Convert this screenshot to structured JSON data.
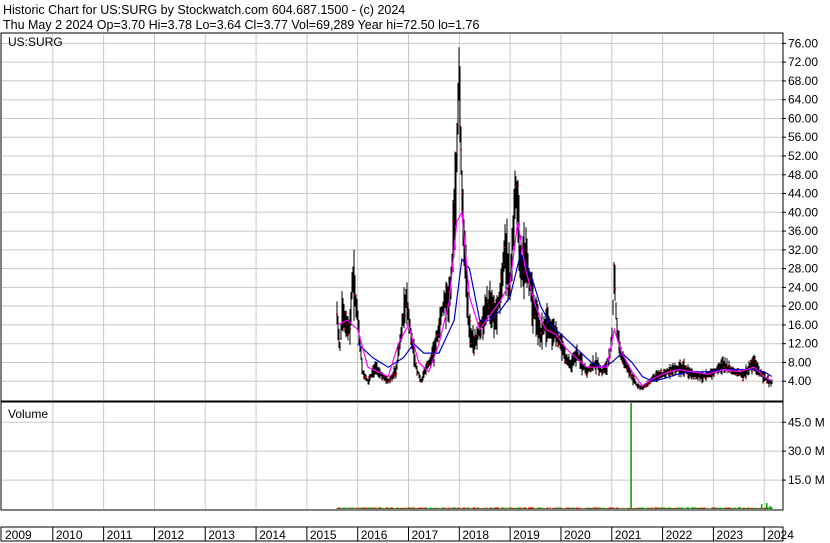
{
  "header": {
    "line1": "Historic Chart for US:SURG by Stockwatch.com 604.687.1500 - (c) 2024",
    "line2": "Thu May  2 2024  Op=3.70  Hi=3.78  Lo=3.64  Cl=3.77  Vol=69,289  Year hi=72.50  lo=1.76"
  },
  "colors": {
    "price_bars": "#000000",
    "down_marks": "#cc0000",
    "ma_short": "#ff00ff",
    "ma_long": "#0000cc",
    "volume_bars": "#009900",
    "grid": "#c8c8c8"
  },
  "chart_data": [
    {
      "type": "line",
      "symbol_label": "US:SURG",
      "y_ticks": [
        "76.00",
        "72.00",
        "68.00",
        "64.00",
        "60.00",
        "56.00",
        "52.00",
        "48.00",
        "44.00",
        "40.00",
        "36.00",
        "32.00",
        "28.00",
        "24.00",
        "20.00",
        "16.00",
        "12.00",
        "8.00",
        "4.00"
      ],
      "ylim": [
        0,
        78
      ],
      "x_years": [
        "2009",
        "2010",
        "2011",
        "2012",
        "2013",
        "2014",
        "2015",
        "2016",
        "2017",
        "2018",
        "2019",
        "2020",
        "2021",
        "2022",
        "2023",
        "2024"
      ],
      "grid": true,
      "series": [
        {
          "key": "price",
          "points": [
            [
              2015.6,
              18
            ],
            [
              2015.65,
              11
            ],
            [
              2015.7,
              19
            ],
            [
              2015.8,
              15
            ],
            [
              2015.85,
              16
            ],
            [
              2015.9,
              27
            ],
            [
              2016.0,
              17
            ],
            [
              2016.1,
              6
            ],
            [
              2016.2,
              4
            ],
            [
              2016.35,
              7
            ],
            [
              2016.5,
              5
            ],
            [
              2016.6,
              4
            ],
            [
              2016.75,
              6
            ],
            [
              2016.85,
              14
            ],
            [
              2016.95,
              22
            ],
            [
              2017.05,
              14
            ],
            [
              2017.15,
              7
            ],
            [
              2017.25,
              4
            ],
            [
              2017.35,
              7
            ],
            [
              2017.5,
              10
            ],
            [
              2017.6,
              16
            ],
            [
              2017.7,
              21
            ],
            [
              2017.8,
              20
            ],
            [
              2017.85,
              28
            ],
            [
              2017.9,
              38
            ],
            [
              2017.95,
              52
            ],
            [
              2018.0,
              72.5
            ],
            [
              2018.05,
              45
            ],
            [
              2018.1,
              32
            ],
            [
              2018.2,
              14
            ],
            [
              2018.3,
              12
            ],
            [
              2018.4,
              15
            ],
            [
              2018.5,
              18
            ],
            [
              2018.6,
              21
            ],
            [
              2018.7,
              18
            ],
            [
              2018.8,
              22
            ],
            [
              2018.9,
              32
            ],
            [
              2019.0,
              25
            ],
            [
              2019.1,
              45
            ],
            [
              2019.15,
              40
            ],
            [
              2019.2,
              28
            ],
            [
              2019.3,
              30
            ],
            [
              2019.4,
              24
            ],
            [
              2019.5,
              18
            ],
            [
              2019.6,
              14
            ],
            [
              2019.7,
              16
            ],
            [
              2019.8,
              15
            ],
            [
              2019.9,
              14
            ],
            [
              2020.0,
              12
            ],
            [
              2020.1,
              9
            ],
            [
              2020.2,
              7
            ],
            [
              2020.3,
              10
            ],
            [
              2020.4,
              8
            ],
            [
              2020.5,
              6
            ],
            [
              2020.6,
              7
            ],
            [
              2020.7,
              8
            ],
            [
              2020.8,
              6
            ],
            [
              2020.9,
              7
            ],
            [
              2021.0,
              12
            ],
            [
              2021.05,
              28
            ],
            [
              2021.1,
              15
            ],
            [
              2021.2,
              9
            ],
            [
              2021.3,
              7
            ],
            [
              2021.4,
              5
            ],
            [
              2021.5,
              3
            ],
            [
              2021.6,
              2.5
            ],
            [
              2021.7,
              3.5
            ],
            [
              2021.8,
              4.5
            ],
            [
              2021.9,
              5
            ],
            [
              2022.0,
              5.5
            ],
            [
              2022.2,
              6.5
            ],
            [
              2022.4,
              7
            ],
            [
              2022.6,
              5.5
            ],
            [
              2022.8,
              5
            ],
            [
              2023.0,
              6
            ],
            [
              2023.2,
              7.5
            ],
            [
              2023.4,
              6
            ],
            [
              2023.6,
              5.5
            ],
            [
              2023.8,
              8
            ],
            [
              2023.9,
              6
            ],
            [
              2024.0,
              5
            ],
            [
              2024.1,
              3.8
            ],
            [
              2024.15,
              3.77
            ]
          ]
        },
        {
          "key": "ma_short",
          "points": [
            [
              2015.6,
              16
            ],
            [
              2015.8,
              17
            ],
            [
              2016.0,
              15
            ],
            [
              2016.2,
              7
            ],
            [
              2016.4,
              6
            ],
            [
              2016.6,
              5
            ],
            [
              2016.8,
              12
            ],
            [
              2017.0,
              16
            ],
            [
              2017.2,
              8
            ],
            [
              2017.4,
              6
            ],
            [
              2017.6,
              12
            ],
            [
              2017.8,
              21
            ],
            [
              2017.95,
              38
            ],
            [
              2018.05,
              40
            ],
            [
              2018.2,
              22
            ],
            [
              2018.4,
              15
            ],
            [
              2018.6,
              18
            ],
            [
              2018.8,
              21
            ],
            [
              2019.0,
              25
            ],
            [
              2019.15,
              38
            ],
            [
              2019.3,
              28
            ],
            [
              2019.5,
              20
            ],
            [
              2019.7,
              15
            ],
            [
              2019.9,
              14
            ],
            [
              2020.1,
              11
            ],
            [
              2020.3,
              9
            ],
            [
              2020.5,
              7
            ],
            [
              2020.7,
              7
            ],
            [
              2020.9,
              7
            ],
            [
              2021.05,
              15
            ],
            [
              2021.2,
              10
            ],
            [
              2021.4,
              6
            ],
            [
              2021.6,
              3
            ],
            [
              2021.8,
              4.5
            ],
            [
              2022.0,
              5.5
            ],
            [
              2022.3,
              6.5
            ],
            [
              2022.6,
              6
            ],
            [
              2022.9,
              5.5
            ],
            [
              2023.2,
              6.5
            ],
            [
              2023.5,
              6
            ],
            [
              2023.8,
              7
            ],
            [
              2024.0,
              5
            ],
            [
              2024.15,
              4
            ]
          ]
        },
        {
          "key": "ma_long",
          "points": [
            [
              2016.0,
              12
            ],
            [
              2016.3,
              9
            ],
            [
              2016.6,
              7
            ],
            [
              2016.9,
              9
            ],
            [
              2017.1,
              12
            ],
            [
              2017.3,
              10
            ],
            [
              2017.6,
              10
            ],
            [
              2017.9,
              17
            ],
            [
              2018.05,
              30
            ],
            [
              2018.2,
              28
            ],
            [
              2018.4,
              17
            ],
            [
              2018.6,
              17
            ],
            [
              2018.8,
              19
            ],
            [
              2019.0,
              22
            ],
            [
              2019.2,
              31
            ],
            [
              2019.4,
              27
            ],
            [
              2019.6,
              20
            ],
            [
              2019.8,
              16
            ],
            [
              2020.0,
              14
            ],
            [
              2020.2,
              12
            ],
            [
              2020.4,
              10
            ],
            [
              2020.6,
              8
            ],
            [
              2020.8,
              7
            ],
            [
              2021.0,
              8
            ],
            [
              2021.2,
              10
            ],
            [
              2021.4,
              8
            ],
            [
              2021.6,
              5
            ],
            [
              2021.8,
              4
            ],
            [
              2022.0,
              4.5
            ],
            [
              2022.3,
              5.5
            ],
            [
              2022.6,
              6
            ],
            [
              2022.9,
              6
            ],
            [
              2023.2,
              6.5
            ],
            [
              2023.5,
              6.5
            ],
            [
              2023.8,
              6.5
            ],
            [
              2024.0,
              6
            ],
            [
              2024.15,
              5
            ]
          ]
        }
      ]
    },
    {
      "type": "bar",
      "title": "Volume",
      "y_ticks": [
        "45.0 M",
        "30.0 M",
        "15.0 M"
      ],
      "ylim": [
        0,
        55
      ],
      "x_years": [
        "2009",
        "2010",
        "2011",
        "2012",
        "2013",
        "2014",
        "2015",
        "2016",
        "2017",
        "2018",
        "2019",
        "2020",
        "2021",
        "2022",
        "2023",
        "2024"
      ],
      "series": [
        {
          "key": "volume",
          "points": [
            [
              2015.8,
              0.4
            ],
            [
              2016.5,
              0.4
            ],
            [
              2017.5,
              0.5
            ],
            [
              2018.0,
              0.6
            ],
            [
              2019.0,
              0.5
            ],
            [
              2020.0,
              0.5
            ],
            [
              2021.0,
              0.6
            ],
            [
              2021.38,
              55
            ],
            [
              2021.6,
              0.8
            ],
            [
              2022.0,
              0.7
            ],
            [
              2022.5,
              0.8
            ],
            [
              2023.0,
              0.8
            ],
            [
              2023.5,
              1.0
            ],
            [
              2023.95,
              2.5
            ],
            [
              2024.05,
              3.2
            ],
            [
              2024.12,
              1.5
            ]
          ]
        }
      ]
    }
  ]
}
